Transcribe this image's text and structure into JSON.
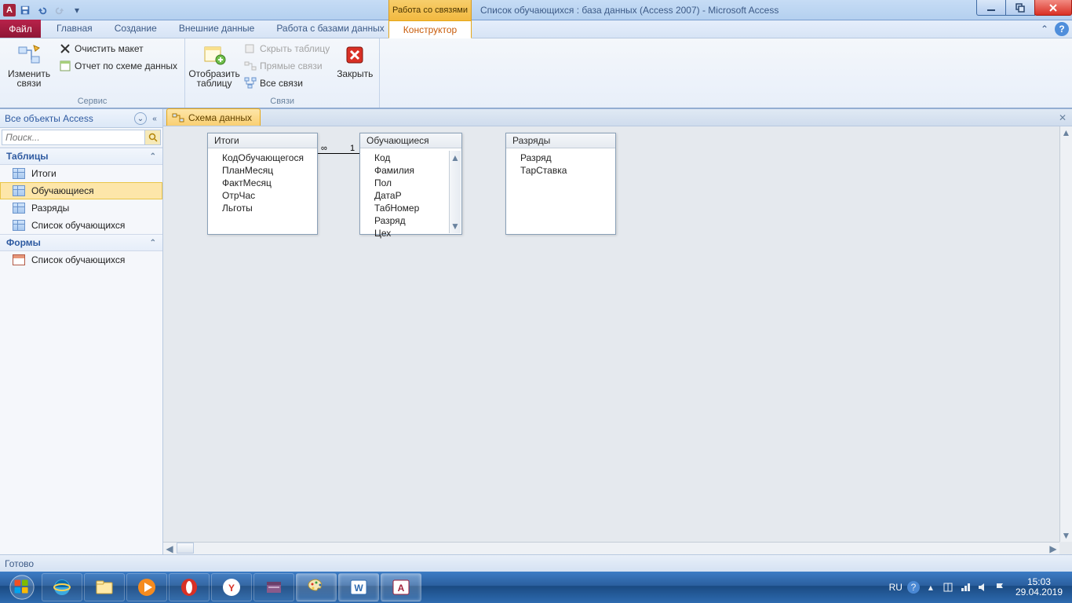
{
  "title": {
    "context_label": "Работа со связями",
    "document": "Список обучающихся : база данных (Access 2007)  -  Microsoft Access"
  },
  "tabs": {
    "file": "Файл",
    "home": "Главная",
    "create": "Создание",
    "external": "Внешние данные",
    "dbtools": "Работа с базами данных",
    "constructor": "Конструктор"
  },
  "ribbon": {
    "grp_tools_label": "Сервис",
    "grp_rel_label": "Связи",
    "edit_rel": "Изменить связи",
    "clear_layout": "Очистить макет",
    "rel_report": "Отчет по схеме данных",
    "show_table": "Отобразить таблицу",
    "hide_table": "Скрыть таблицу",
    "direct_rel": "Прямые связи",
    "all_rel": "Все связи",
    "close": "Закрыть"
  },
  "nav": {
    "title": "Все объекты Access",
    "search_ph": "Поиск...",
    "cat_tables": "Таблицы",
    "cat_forms": "Формы",
    "tables": [
      "Итоги",
      "Обучающиеся",
      "Разряды",
      "Список обучающихся"
    ],
    "forms": [
      "Список обучающихся"
    ]
  },
  "doc_tab": "Схема данных",
  "diagram": {
    "box1": {
      "title": "Итоги",
      "fields": [
        "КодОбучающегося",
        "ПланМесяц",
        "ФактМесяц",
        "ОтрЧас",
        "Льготы"
      ]
    },
    "box2": {
      "title": "Обучающиеся",
      "fields": [
        "Код",
        "Фамилия",
        "Пол",
        "ДатаР",
        "ТабНомер",
        "Разряд",
        "Цех"
      ]
    },
    "box3": {
      "title": "Разряды",
      "fields": [
        "Разряд",
        "ТарСтавка"
      ]
    },
    "rel_inf": "∞",
    "rel_one": "1"
  },
  "status": "Готово",
  "tray": {
    "lang": "RU",
    "time": "15:03",
    "date": "29.04.2019"
  }
}
